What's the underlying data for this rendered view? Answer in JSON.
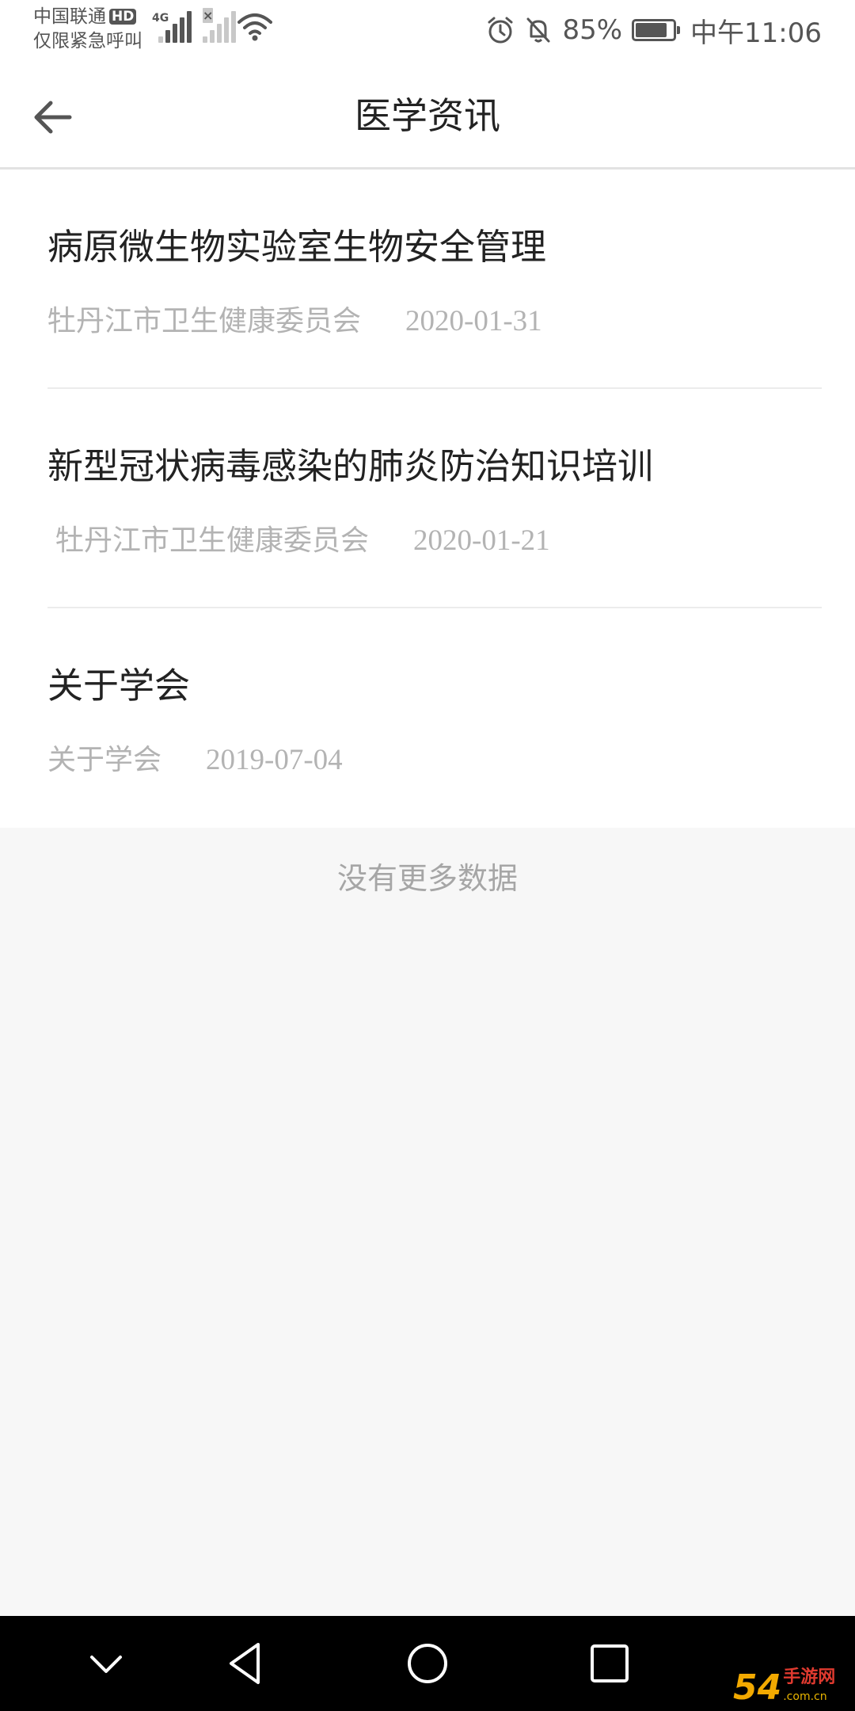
{
  "status_bar": {
    "carrier_line1": "中国联通",
    "hd_badge": "HD",
    "carrier_line2": "仅限紧急呼叫",
    "network_type": "4G",
    "icons": [
      "signal-icon",
      "signal-weak-icon",
      "wifi-icon",
      "alarm-icon",
      "mute-icon",
      "battery-icon"
    ],
    "battery_percent_text": "85%",
    "battery_level": 0.85,
    "time": "中午11:06"
  },
  "header": {
    "title": "医学资讯",
    "back_icon": "arrow-left-icon"
  },
  "news": [
    {
      "title": "病原微生物实验室生物安全管理",
      "source": "牡丹江市卫生健康委员会",
      "date": "2020-01-31"
    },
    {
      "title": "新型冠状病毒感染的肺炎防治知识培训",
      "source": "牡丹江市卫生健康委员会",
      "date": "2020-01-21"
    },
    {
      "title": "关于学会",
      "source": "关于学会",
      "date": "2019-07-04"
    }
  ],
  "footer_text": "没有更多数据",
  "nav_bar": {
    "icons": [
      "chevron-down-icon",
      "back-triangle-icon",
      "home-circle-icon",
      "recents-square-icon"
    ]
  },
  "watermark": {
    "logo": "54",
    "text": "手游网",
    "domain": ".com.cn"
  },
  "colors": {
    "background": "#f7f7f7",
    "title_text": "#222222",
    "meta_text": "#b3b3b3",
    "footer_text": "#a6a6a6",
    "nav_bar": "#000000"
  }
}
